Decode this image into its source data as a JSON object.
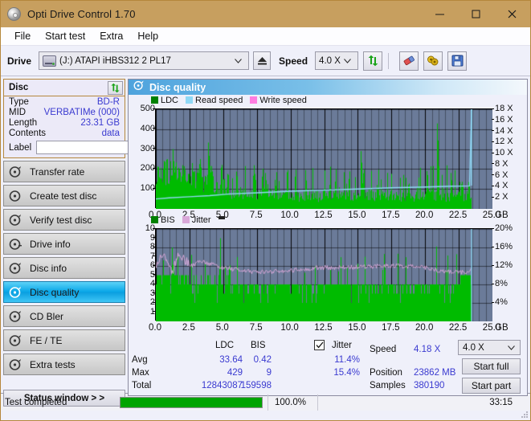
{
  "window": {
    "title": "Opti Drive Control 1.70",
    "app_icon": "disc-icon",
    "minimize": "—",
    "maximize": "□",
    "close": "✕",
    "titlebar_color": "#c79f5f"
  },
  "menu": {
    "items": [
      "File",
      "Start test",
      "Extra",
      "Help"
    ]
  },
  "toolbar": {
    "drive_label": "Drive",
    "drive_value": "(J:)   ATAPI iHBS312  2 PL17",
    "eject_icon": "eject-icon",
    "speed_label": "Speed",
    "speed_value": "4.0 X",
    "refresh_icon": "refresh-icon",
    "eraser_icon": "eraser-icon",
    "bulb_icon": "bulb-icon",
    "save_icon": "floppy-save-icon",
    "chevron": "⌄"
  },
  "disc": {
    "title": "Disc",
    "refresh_icon": "refresh-icon",
    "rows": [
      {
        "key": "Type",
        "value": "BD-R"
      },
      {
        "key": "MID",
        "value": "VERBATIMe (000)"
      },
      {
        "key": "Length",
        "value": "23.31 GB"
      },
      {
        "key": "Contents",
        "value": "data"
      }
    ],
    "label_key": "Label",
    "label_value": "",
    "label_placeholder": "",
    "label_button_icon": "disc-icon"
  },
  "nav": {
    "items": [
      {
        "label": "Transfer rate",
        "icon": "disc-icon",
        "selected": false
      },
      {
        "label": "Create test disc",
        "icon": "disc-icon",
        "selected": false
      },
      {
        "label": "Verify test disc",
        "icon": "disc-icon",
        "selected": false
      },
      {
        "label": "Drive info",
        "icon": "disc-icon",
        "selected": false
      },
      {
        "label": "Disc info",
        "icon": "disc-icon",
        "selected": false
      },
      {
        "label": "Disc quality",
        "icon": "disc-icon",
        "selected": true
      },
      {
        "label": "CD Bler",
        "icon": "disc-icon",
        "selected": false
      },
      {
        "label": "FE / TE",
        "icon": "disc-icon",
        "selected": false
      },
      {
        "label": "Extra tests",
        "icon": "disc-icon",
        "selected": false
      }
    ],
    "status_window": "Status window > >"
  },
  "panel": {
    "header_title": "Disc quality",
    "header_icon": "disc-icon"
  },
  "stats": {
    "col_headers": [
      "LDC",
      "BIS"
    ],
    "jitter_label": "Jitter",
    "jitter_checked": true,
    "rows": [
      {
        "name": "Avg",
        "ldc": "33.64",
        "bis": "0.42",
        "jitter": "11.4%"
      },
      {
        "name": "Max",
        "ldc": "429",
        "bis": "9",
        "jitter": "15.4%"
      },
      {
        "name": "Total",
        "ldc": "12843087",
        "bis": "159598",
        "jitter": ""
      }
    ],
    "speed_label": "Speed",
    "speed_value": "4.18 X",
    "position_label": "Position",
    "position_value": "23862 MB",
    "samples_label": "Samples",
    "samples_value": "380190",
    "speed_select": "4.0 X",
    "start_full": "Start full",
    "start_part": "Start part"
  },
  "statusbar": {
    "text": "Test completed",
    "progress_pct": 100.0,
    "progress_label": "100.0%",
    "elapsed": "33:15"
  },
  "colors": {
    "ldc_green": "#00bb00",
    "read_speed_blue": "#8fd8f5",
    "write_speed_pink": "#ff7de0",
    "bis_green": "#00bb00",
    "jitter_pink": "#d9a8d9",
    "plot_bg": "#6b7b99",
    "grid": "#000000",
    "accent": "#3a3ad0"
  },
  "chart_data": [
    {
      "type": "line",
      "name": "top-chart-ldc-readspeed",
      "title": "",
      "xlabel": "GB",
      "ylabel": "LDC",
      "y2label": "X",
      "xlim": [
        0,
        25
      ],
      "ylim": [
        0,
        500
      ],
      "y2lim": [
        0,
        18
      ],
      "grid": true,
      "xticks": [
        0.0,
        2.5,
        5.0,
        7.5,
        10.0,
        12.5,
        15.0,
        17.5,
        20.0,
        22.5,
        25.0
      ],
      "xticklabels": [
        "0.0",
        "2.5",
        "5.0",
        "7.5",
        "10.0",
        "12.5",
        "15.0",
        "17.5",
        "20.0",
        "22.5",
        "25.0"
      ],
      "x_unit": "GB",
      "yticks": [
        100,
        200,
        300,
        400,
        500
      ],
      "yticklabels": [
        "100",
        "200",
        "300",
        "400",
        "500"
      ],
      "y2ticks": [
        2,
        4,
        6,
        8,
        10,
        12,
        14,
        16,
        18
      ],
      "y2ticklabels": [
        "2 X",
        "4 X",
        "6 X",
        "8 X",
        "10 X",
        "12 X",
        "14 X",
        "16 X",
        "18 X"
      ],
      "legend": [
        {
          "name": "LDC",
          "color": "#008000"
        },
        {
          "name": "Read speed",
          "color": "#8fd8f5"
        },
        {
          "name": "Write speed",
          "color": "#ff7de0"
        }
      ],
      "legend_position": "top-left",
      "series": [
        {
          "name": "LDC",
          "type": "area",
          "color": "#00bb00",
          "x_range": [
            0,
            23.4
          ],
          "baseline_avg": 33.64,
          "max": 429,
          "peaks": [
            {
              "x": 1.25,
              "y": 300
            },
            {
              "x": 1.45,
              "y": 212
            },
            {
              "x": 1.7,
              "y": 205
            },
            {
              "x": 2.0,
              "y": 172
            },
            {
              "x": 3.9,
              "y": 333
            },
            {
              "x": 4.1,
              "y": 215
            },
            {
              "x": 7.3,
              "y": 219
            },
            {
              "x": 8.1,
              "y": 180
            },
            {
              "x": 9.7,
              "y": 172
            },
            {
              "x": 11.1,
              "y": 178
            },
            {
              "x": 14.3,
              "y": 150
            },
            {
              "x": 15.2,
              "y": 290
            },
            {
              "x": 16.4,
              "y": 120
            },
            {
              "x": 20.9,
              "y": 429
            },
            {
              "x": 21.9,
              "y": 180
            },
            {
              "x": 23.2,
              "y": 135
            }
          ],
          "band_top_avg": 95,
          "band_top_head": 150
        },
        {
          "name": "Read speed",
          "type": "line",
          "color": "#8fd8f5",
          "points": [
            {
              "x": 0.0,
              "y": 1.8
            },
            {
              "x": 1.0,
              "y": 2.0
            },
            {
              "x": 2.5,
              "y": 2.2
            },
            {
              "x": 4.0,
              "y": 2.4
            },
            {
              "x": 5.5,
              "y": 2.7
            },
            {
              "x": 7.5,
              "y": 2.9
            },
            {
              "x": 10.0,
              "y": 3.2
            },
            {
              "x": 12.5,
              "y": 3.4
            },
            {
              "x": 15.0,
              "y": 3.6
            },
            {
              "x": 17.5,
              "y": 3.8
            },
            {
              "x": 20.0,
              "y": 3.95
            },
            {
              "x": 22.0,
              "y": 4.1
            },
            {
              "x": 23.3,
              "y": 4.15
            },
            {
              "x": 23.45,
              "y": 18.0
            }
          ]
        },
        {
          "name": "Write speed",
          "type": "line",
          "color": "#ff7de0",
          "points": []
        }
      ]
    },
    {
      "type": "line",
      "name": "bottom-chart-bis-jitter",
      "title": "",
      "xlabel": "GB",
      "ylabel": "BIS",
      "y2label": "%",
      "xlim": [
        0,
        25
      ],
      "ylim": [
        0,
        10
      ],
      "y2lim": [
        0,
        20
      ],
      "grid": true,
      "xticks": [
        0.0,
        2.5,
        5.0,
        7.5,
        10.0,
        12.5,
        15.0,
        17.5,
        20.0,
        22.5,
        25.0
      ],
      "xticklabels": [
        "0.0",
        "2.5",
        "5.0",
        "7.5",
        "10.0",
        "12.5",
        "15.0",
        "17.5",
        "20.0",
        "22.5",
        "25.0"
      ],
      "x_unit": "GB",
      "yticks": [
        1,
        2,
        3,
        4,
        5,
        6,
        7,
        8,
        9,
        10
      ],
      "yticklabels": [
        "1",
        "2",
        "3",
        "4",
        "5",
        "6",
        "7",
        "8",
        "9",
        "10"
      ],
      "y2ticks": [
        4,
        8,
        12,
        16,
        20
      ],
      "y2ticklabels": [
        "4%",
        "8%",
        "12%",
        "16%",
        "20%"
      ],
      "legend": [
        {
          "name": "BIS",
          "color": "#008000"
        },
        {
          "name": "Jitter",
          "color": "#d9a8d9"
        }
      ],
      "legend_position": "top-left",
      "series": [
        {
          "name": "BIS",
          "type": "area",
          "color": "#00bb00",
          "x_range": [
            0,
            23.4
          ],
          "baseline_avg": 0.42,
          "max": 9,
          "band_top_head": 5.0,
          "band_top_mid": 4.0,
          "peaks": [
            {
              "x": 1.2,
              "y": 8.0
            },
            {
              "x": 2.6,
              "y": 7.2
            },
            {
              "x": 4.8,
              "y": 9.0
            },
            {
              "x": 11.8,
              "y": 6.0
            },
            {
              "x": 17.0,
              "y": 5.6
            },
            {
              "x": 20.8,
              "y": 8.1
            },
            {
              "x": 23.0,
              "y": 5.2
            }
          ]
        },
        {
          "name": "Jitter",
          "type": "line",
          "color": "#d9a8d9",
          "avg_pct": 11.4,
          "max_pct": 15.4,
          "points": [
            {
              "x": 0.0,
              "y": 11.6
            },
            {
              "x": 0.4,
              "y": 14.6
            },
            {
              "x": 0.8,
              "y": 13.0
            },
            {
              "x": 1.2,
              "y": 10.4
            },
            {
              "x": 1.6,
              "y": 14.4
            },
            {
              "x": 2.0,
              "y": 13.6
            },
            {
              "x": 2.6,
              "y": 12.0
            },
            {
              "x": 3.2,
              "y": 13.0
            },
            {
              "x": 4.0,
              "y": 12.4
            },
            {
              "x": 5.0,
              "y": 11.6
            },
            {
              "x": 6.0,
              "y": 11.2
            },
            {
              "x": 7.5,
              "y": 10.6
            },
            {
              "x": 9.0,
              "y": 10.8
            },
            {
              "x": 10.5,
              "y": 11.2
            },
            {
              "x": 12.0,
              "y": 11.6
            },
            {
              "x": 13.5,
              "y": 11.6
            },
            {
              "x": 15.0,
              "y": 11.8
            },
            {
              "x": 16.5,
              "y": 12.0
            },
            {
              "x": 18.0,
              "y": 12.0
            },
            {
              "x": 19.5,
              "y": 11.8
            },
            {
              "x": 21.0,
              "y": 11.0
            },
            {
              "x": 22.0,
              "y": 10.8
            },
            {
              "x": 23.3,
              "y": 10.6
            }
          ]
        }
      ]
    }
  ]
}
